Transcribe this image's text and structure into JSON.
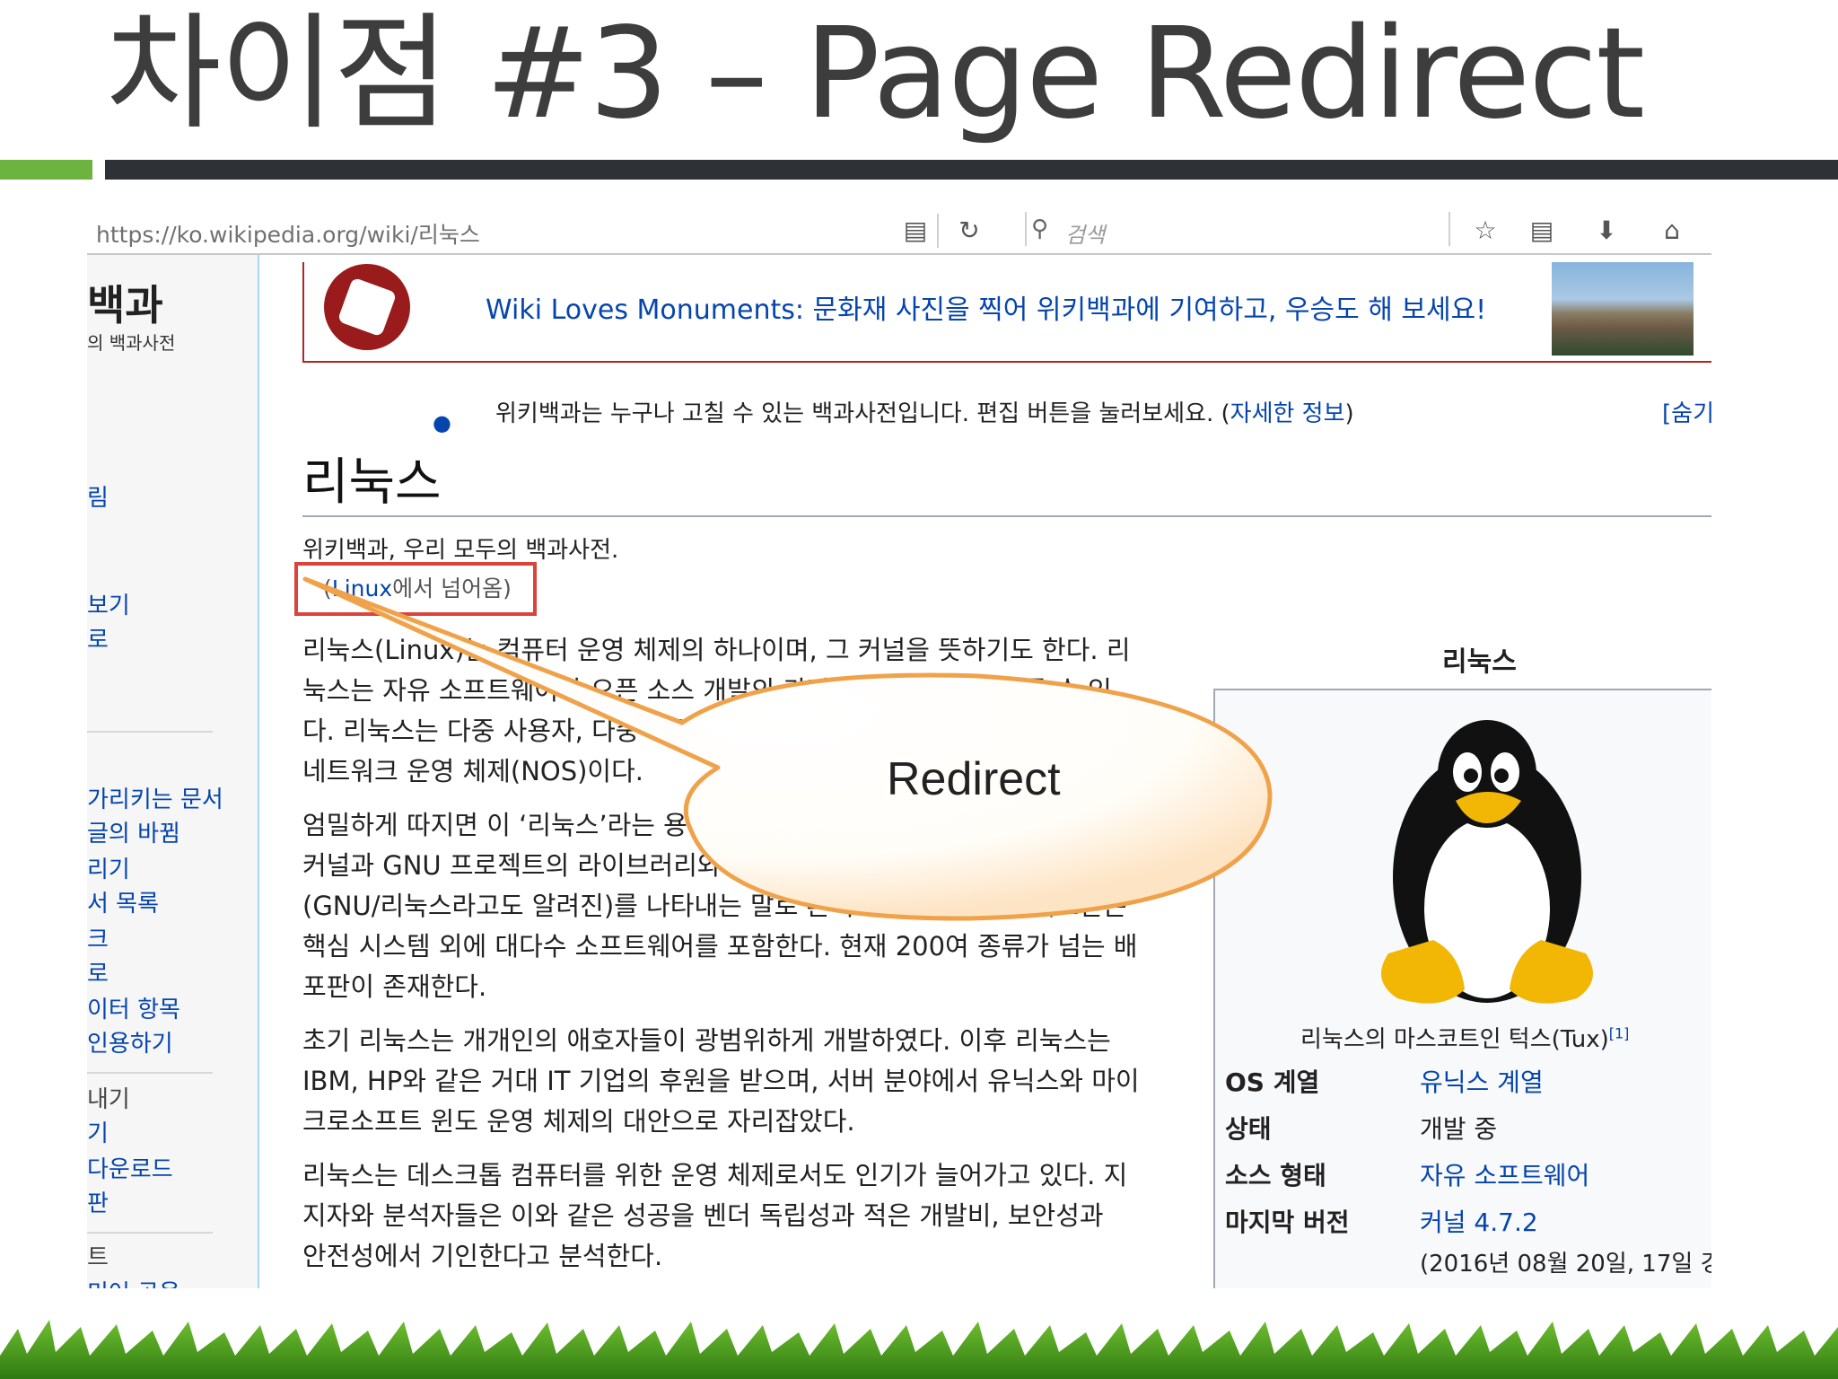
{
  "slide": {
    "title": "차이점 #3 – Page Redirect"
  },
  "browser": {
    "url": "https://ko.wikipedia.org/wiki/리눅스",
    "search_placeholder": "검색",
    "icons": [
      "reader-mode-icon",
      "reload-icon",
      "search-icon",
      "bookmark-star-icon",
      "reading-list-icon",
      "download-icon",
      "home-icon",
      "chat-icon"
    ]
  },
  "sidebar": {
    "logo": "백과",
    "logo_sub": "의 백과사전",
    "items": [
      "림",
      "보기",
      "로",
      "가리키는 문서",
      "글의 바뀜",
      "리기",
      "서 목록",
      "크",
      "로",
      "이터 항목",
      "인용하기",
      "내기",
      "기",
      "다운로드",
      "판",
      "트",
      "미어 공용"
    ]
  },
  "banner": {
    "text": "Wiki Loves Monuments: 문화재 사진을 찍어 위키백과에 기여하고, 우승도 해 보세요!"
  },
  "notice": {
    "text": "위키백과는 누구나 고칠 수 있는 백과사전입니다. 편집 버튼을 눌러보세요. (",
    "link": "자세한 정보",
    "close": ")",
    "right": "[숨기"
  },
  "article": {
    "title": "리눅스",
    "tagline": "위키백과, 우리 모두의 백과사전.",
    "redirect_link": "Linux",
    "redirect_rest": "에서 넘어옴)",
    "redirect_open": "(",
    "lines": [
      "리눅스(Linux)는 컴퓨터 운영 체제의 하나이며, 그 커널을 뜻하기도 한다. 리",
      "눅스는 자유 소프트웨어와 오픈 소스 개발의 가장 유명한 표본으로 들 수 있",
      "다. 리눅스는 다중 사용자, 다중 작업(멀티태스킹), 다중 스레드를 지원하는",
      "네트워크 운영 체제(NOS)이다.",
      "엄밀하게 따지면 이 ‘리눅스’라는 용어는 리눅스 커널만을 뜻하지만, 리눅스",
      "커널과 GNU 프로젝트의 라이브러리와 도구들이 포함된 전체 운영 체제",
      "(GNU/리눅스라고도 알려진)를 나타내는 말로 흔히 쓰인다. 리눅스 배포판은",
      "핵심 시스템 외에 대다수 소프트웨어를 포함한다. 현재 200여 종류가 넘는 배",
      "포판이 존재한다.",
      "초기 리눅스는 개개인의 애호자들이 광범위하게 개발하였다. 이후 리눅스는",
      "IBM, HP와 같은 거대 IT 기업의 후원을 받으며, 서버 분야에서 유닉스와 마이",
      "크로소프트 윈도 운영 체제의 대안으로 자리잡았다.",
      "리눅스는 데스크톱 컴퓨터를 위한 운영 체제로서도 인기가 늘어가고 있다. 지",
      "지자와 분석자들은 이와 같은 성공을 벤더 독립성과 적은 개발비, 보안성과",
      "안전성에서 기인한다고 분석한다."
    ]
  },
  "infobox": {
    "title": "리눅스",
    "caption": "리눅스의 마스코트인 턱스(Tux)",
    "caption_ref": "[1]",
    "rows": [
      {
        "key": "OS 계열",
        "value": "유닉스 계열"
      },
      {
        "key": "상태",
        "value": "개발 중"
      },
      {
        "key": "소스 형태",
        "value": "자유 소프트웨어"
      },
      {
        "key": "마지막 버전",
        "value": "커널 4.7.2"
      }
    ],
    "date": "(2016년 08월 20일, 17일 경"
  },
  "callout": {
    "text": "Redirect"
  }
}
